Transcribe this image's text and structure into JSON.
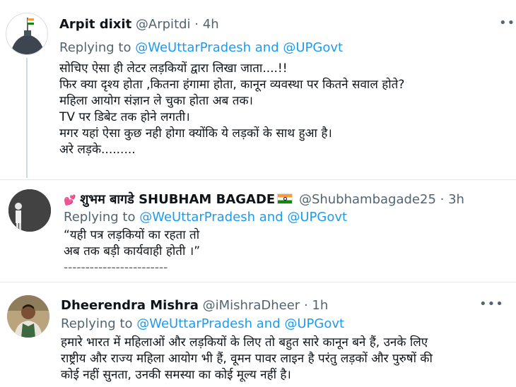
{
  "tweets": [
    {
      "name": "Arpit dixit",
      "handle": "@Arpitdi",
      "sep": "·",
      "time": "4h",
      "replying_prefix": "Replying to",
      "replying_mention1": "@WeUttarPradesh",
      "replying_and": "and",
      "replying_mention2": "@UPGovt",
      "lines": [
        "सोचिए ऐसा ही लेटर लड़कियों द्वारा लिखा जाता....!!",
        "फिर क्या दृश्य होता ,कितना हंगामा होता, कानून व्यवस्था पर कितने सवाल होते?",
        "महिला आयोग संज्ञान ले चुका होता अब तक।",
        "TV पर डिबेट तक होने लगती।",
        "मगर यहां ऐसा कुछ नही होगा क्योंकि ये लड़कों के साथ हुआ है।",
        "अरे लड़के........."
      ],
      "more_icon": "ellipsis-icon"
    },
    {
      "name_emoji": "💕",
      "name": "शुभम बागडे SHUBHAM BAGADE",
      "handle": "@Shubhambagade25",
      "sep": "·",
      "time": "3h",
      "replying_prefix": "Replying to",
      "replying_mention1": "@WeUttarPradesh",
      "replying_and": "and",
      "replying_mention2": "@UPGovt",
      "lines": [
        "“यही पत्र लड़कियों का रहता तो",
        "अब तक बड़ी कार्यवाही होती ।”",
        "------------------------"
      ]
    },
    {
      "name": "Dheerendra Mishra",
      "handle": "@iMishraDheer",
      "sep": "·",
      "time": "1h",
      "replying_prefix": "Replying to",
      "replying_mention1": "@WeUttarPradesh",
      "replying_and": "and",
      "replying_mention2": "@UPGovt",
      "lines": [
        "हमारे भारत में महिलाओं और लड़कियों के लिए तो बहुत सारे कानून बने हैं, उनके लिए",
        "राष्ट्रीय और राज्य महिला आयोग भी हैं, वूमन पावर लाइन है परंतु लड़कों और पुरुषों की",
        "कोई नहीं सुनता, उनकी समस्या का कोई मूल्य नहीं है।"
      ],
      "more_icon": "ellipsis-icon"
    }
  ],
  "colors": {
    "link": "#1d9bf0",
    "secondary": "#536471",
    "text": "#0f1419"
  }
}
